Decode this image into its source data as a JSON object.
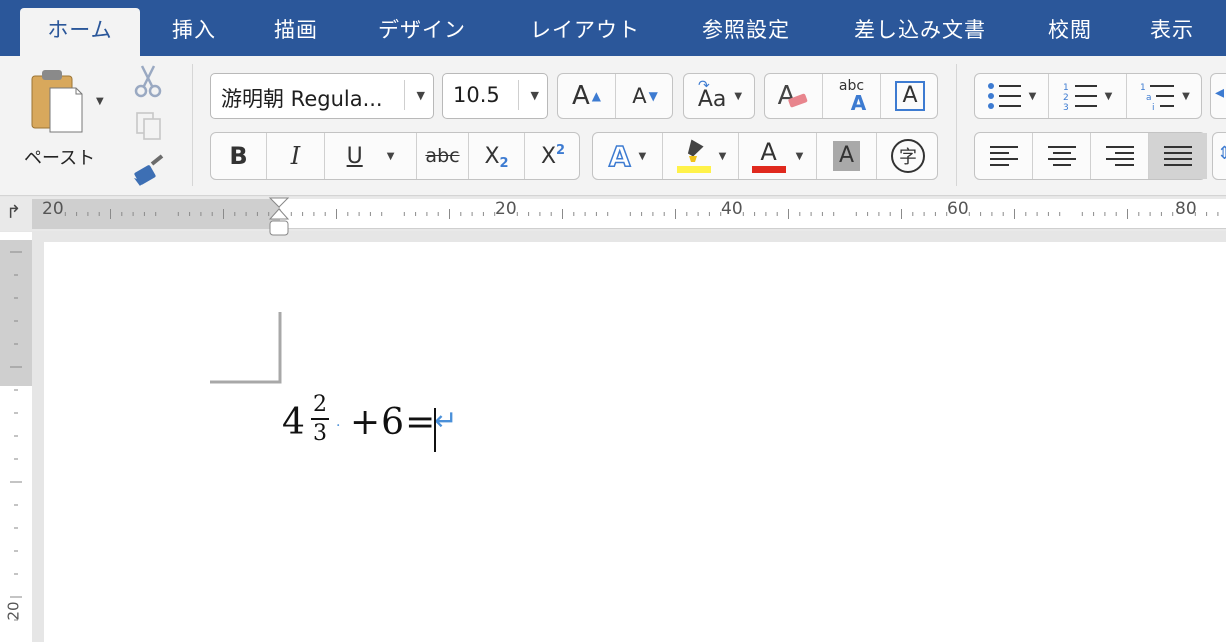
{
  "tabs": [
    {
      "label": "ホーム",
      "active": true
    },
    {
      "label": "挿入"
    },
    {
      "label": "描画"
    },
    {
      "label": "デザイン"
    },
    {
      "label": "レイアウト"
    },
    {
      "label": "参照設定"
    },
    {
      "label": "差し込み文書"
    },
    {
      "label": "校閲"
    },
    {
      "label": "表示"
    }
  ],
  "clipboard": {
    "paste_label": "ペースト"
  },
  "font": {
    "name": "游明朝 Regula...",
    "size": "10.5"
  },
  "format_buttons": {
    "bold": "B",
    "italic": "I",
    "underline": "U",
    "strike": "abc",
    "subscript": "X",
    "subscript_mark": "2",
    "superscript": "X",
    "superscript_mark": "2"
  },
  "grow_shrink": {
    "grow": "A",
    "shrink": "A"
  },
  "change_case": {
    "label": "Aa"
  },
  "clear_format": {
    "label": "A"
  },
  "phonetic": {
    "small": "abc",
    "big": "A"
  },
  "char_border": {
    "label": "A"
  },
  "text_effect": {
    "label": "A"
  },
  "font_color": {
    "label": "A",
    "color": "#e0291e"
  },
  "char_shading": {
    "label": "A"
  },
  "enclose": {
    "label": "字"
  },
  "highlight": {
    "color": "#fff24a"
  },
  "ruler": {
    "marks": [
      "20",
      "20",
      "40",
      "60",
      "80"
    ],
    "vertical_mark": "20"
  },
  "document": {
    "whole": "4",
    "numerator": "2",
    "denominator": "3",
    "rest": "+6=",
    "pilcrow": "↵"
  },
  "colors": {
    "ribbon_blue": "#2b579a",
    "accent_blue": "#4a90d9"
  }
}
